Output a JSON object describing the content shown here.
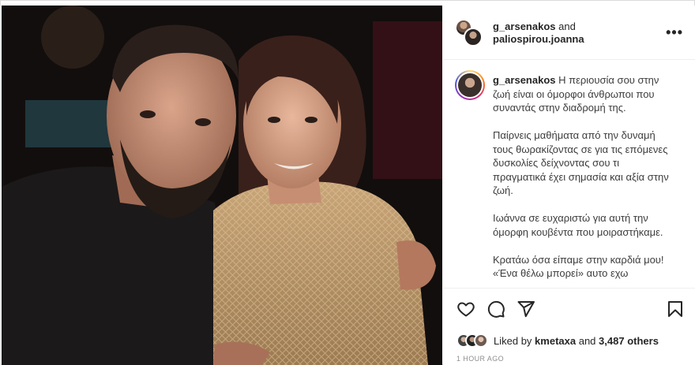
{
  "header": {
    "user1": "g_arsenakos",
    "and_label": "and",
    "user2": "paliospirou.joanna",
    "more_icon": "more-horizontal-icon"
  },
  "caption": {
    "username": "g_arsenakos",
    "body": "Η περιουσία σου στην ζωή είναι οι όμορφοι άνθρωποι που συναντάς στην διαδρομή της.\n\nΠαίρνεις μαθήματα από την δυναμή τους θωρακίζοντας σε για τις επόμενες δυσκολίες δείχνοντας σου τι πραγματικά έχει σημασία και αξία στην ζωή.\n\nΙωάννα σε ευχαριστώ για αυτή την όμορφη κουβέντα που μοιραστήκαμε.\n\nΚρατάω όσα είπαμε στην καρδιά μου! «Ένα θέλω μπορεί» αυτο εχω"
  },
  "actions": {
    "icons": [
      "heart-icon",
      "comment-icon",
      "share-icon",
      "bookmark-icon"
    ]
  },
  "likes": {
    "prefix": "Liked by",
    "user": "kmetaxa",
    "middle": "and",
    "count": "3,487 others"
  },
  "timestamp": "1 HOUR AGO",
  "colors": {
    "text": "#262626",
    "muted": "#8e8e8e",
    "border": "#efefef"
  }
}
